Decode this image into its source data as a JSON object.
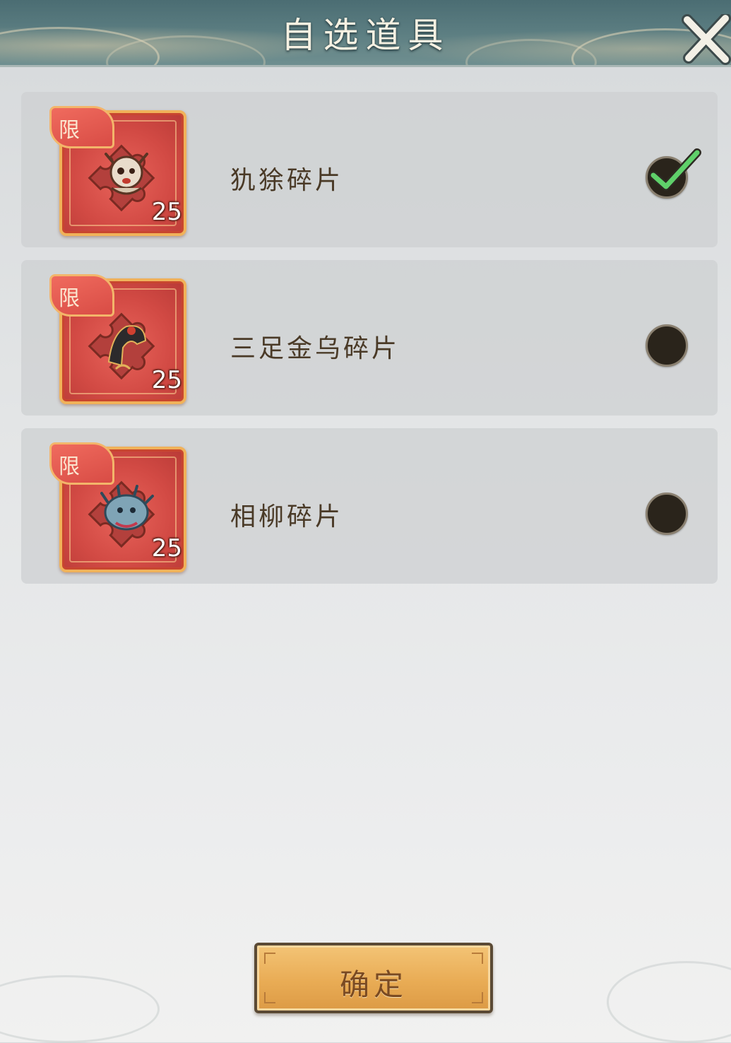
{
  "header": {
    "title": "自选道具"
  },
  "items": [
    {
      "name": "犰狳碎片",
      "tag": "限",
      "count": "25",
      "selected": true,
      "creature_color": "#e9dccb"
    },
    {
      "name": "三足金乌碎片",
      "tag": "限",
      "count": "25",
      "selected": false,
      "creature_color": "#2c2a2c"
    },
    {
      "name": "相柳碎片",
      "tag": "限",
      "count": "25",
      "selected": false,
      "creature_color": "#7fa4b6"
    }
  ],
  "footer": {
    "confirm_label": "确定"
  },
  "colors": {
    "header_bg": "#5a7c80",
    "icon_frame": "#d24a44",
    "icon_border": "#f0b25a",
    "check": "#5fd06a",
    "confirm_bg": "#e9ac55"
  }
}
